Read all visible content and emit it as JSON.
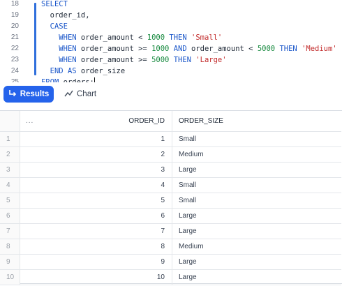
{
  "editor": {
    "lines": [
      {
        "n": "18",
        "t": "SELECT"
      },
      {
        "n": "19",
        "t": "  order_id,"
      },
      {
        "n": "20",
        "t": "  CASE"
      },
      {
        "n": "21",
        "t": "    WHEN order_amount < 1000 THEN 'Small'"
      },
      {
        "n": "22",
        "t": "    WHEN order_amount >= 1000 AND order_amount < 5000 THEN 'Medium'"
      },
      {
        "n": "23",
        "t": "    WHEN order_amount >= 5000 THEN 'Large'"
      },
      {
        "n": "24",
        "t": "  END AS order_size"
      },
      {
        "n": "25",
        "t": "FROM orders;"
      },
      {
        "n": "26",
        "t": ""
      }
    ]
  },
  "tabs": {
    "results_label": "Results",
    "chart_label": "Chart"
  },
  "grid": {
    "dots": "...",
    "columns": [
      "ORDER_ID",
      "ORDER_SIZE"
    ],
    "rows": [
      {
        "idx": "1",
        "order_id": "1",
        "order_size": "Small"
      },
      {
        "idx": "2",
        "order_id": "2",
        "order_size": "Medium"
      },
      {
        "idx": "3",
        "order_id": "3",
        "order_size": "Large"
      },
      {
        "idx": "4",
        "order_id": "4",
        "order_size": "Small"
      },
      {
        "idx": "5",
        "order_id": "5",
        "order_size": "Small"
      },
      {
        "idx": "6",
        "order_id": "6",
        "order_size": "Large"
      },
      {
        "idx": "7",
        "order_id": "7",
        "order_size": "Large"
      },
      {
        "idx": "8",
        "order_id": "8",
        "order_size": "Medium"
      },
      {
        "idx": "9",
        "order_id": "9",
        "order_size": "Large"
      },
      {
        "idx": "10",
        "order_id": "10",
        "order_size": "Large"
      }
    ]
  },
  "colors": {
    "accent": "#2563eb",
    "keyword": "#1a56c9",
    "number": "#16893e",
    "string": "#c22b2b"
  },
  "icons": {
    "results": "return-arrow-icon",
    "chart": "trend-line-icon"
  }
}
